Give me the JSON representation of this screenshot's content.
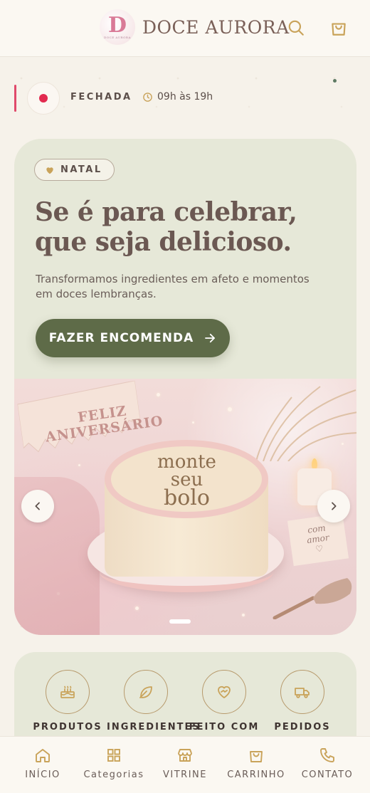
{
  "header": {
    "logo_letter": "D",
    "logo_small": "DOCE AURORA",
    "brand": "DOCE AURORA",
    "icons": [
      "search-icon",
      "shopping-bag-icon"
    ]
  },
  "status": {
    "label": "FECHADA",
    "hours": "09h às 19h",
    "status_color": "#e22a4f"
  },
  "hero": {
    "badge": "NATAL",
    "headline_line1": "Se é para celebrar,",
    "headline_line2": "que seja delicioso.",
    "subtitle": "Transformamos ingredientes em afeto e momentos em doces lembranças.",
    "cta": "FAZER ENCOMENDA",
    "image": {
      "banner_line1": "FELIZ",
      "banner_line2": "ANIVERSÁRIO",
      "cake_line1": "monte",
      "cake_line2": "seu",
      "cake_line3": "bolo",
      "note_line1": "com",
      "note_line2": "amor"
    }
  },
  "categories": [
    {
      "label": "PRODUTOS",
      "icon": "cake-icon"
    },
    {
      "label": "INGREDIENTES",
      "icon": "leaf-icon"
    },
    {
      "label": "FEITO COM",
      "icon": "handshake-heart-icon"
    },
    {
      "label": "PEDIDOS",
      "icon": "delivery-truck-icon"
    }
  ],
  "nav": [
    {
      "label": "INÍCIO",
      "icon": "home-icon"
    },
    {
      "label": "Categorias",
      "icon": "grid-icon"
    },
    {
      "label": "VITRINE",
      "icon": "storefront-icon"
    },
    {
      "label": "CARRINHO",
      "icon": "shopping-bag-icon"
    },
    {
      "label": "CONTATO",
      "icon": "phone-icon"
    }
  ],
  "colors": {
    "accent_green": "#5e6b48",
    "gold": "#c9a35a",
    "card_bg": "#e6e8d8",
    "page_bg": "#f6f2ea"
  }
}
